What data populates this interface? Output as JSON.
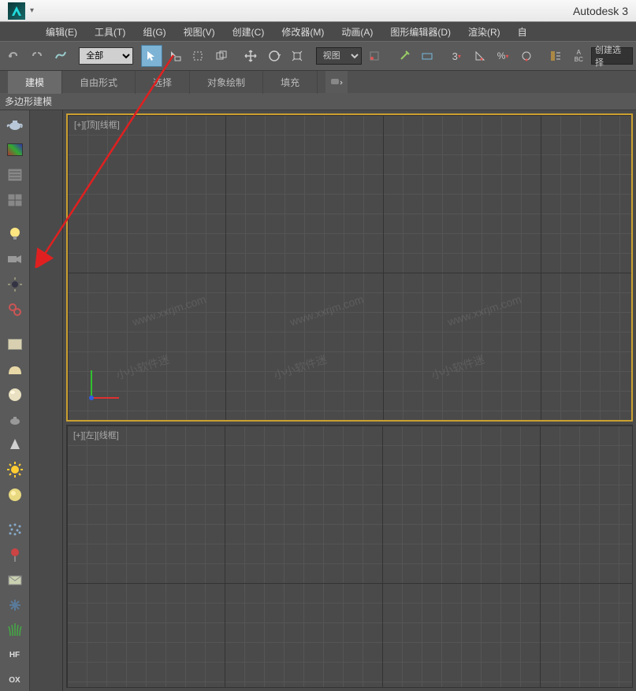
{
  "app": {
    "title": "Autodesk 3",
    "icon_name": "3dsmax-icon"
  },
  "menu": [
    "编辑(E)",
    "工具(T)",
    "组(G)",
    "视图(V)",
    "创建(C)",
    "修改器(M)",
    "动画(A)",
    "图形编辑器(D)",
    "渲染(R)",
    "自"
  ],
  "toolbar": {
    "filter_dropdown": "全部",
    "ref_dropdown": "视图",
    "create_label": "创建选择"
  },
  "ribbon": {
    "tabs": [
      "建模",
      "自由形式",
      "选择",
      "对象绘制",
      "填充"
    ],
    "active": 0,
    "sub": "多边形建模"
  },
  "viewports": {
    "top": {
      "label": "[+][顶][线框]"
    },
    "left": {
      "label": "[+][左][线框]"
    }
  },
  "watermarks": {
    "url": "www.xxrjm.com",
    "text": "小小软件迷"
  },
  "lefticons": {
    "hf": "HF",
    "ox": "OX"
  }
}
